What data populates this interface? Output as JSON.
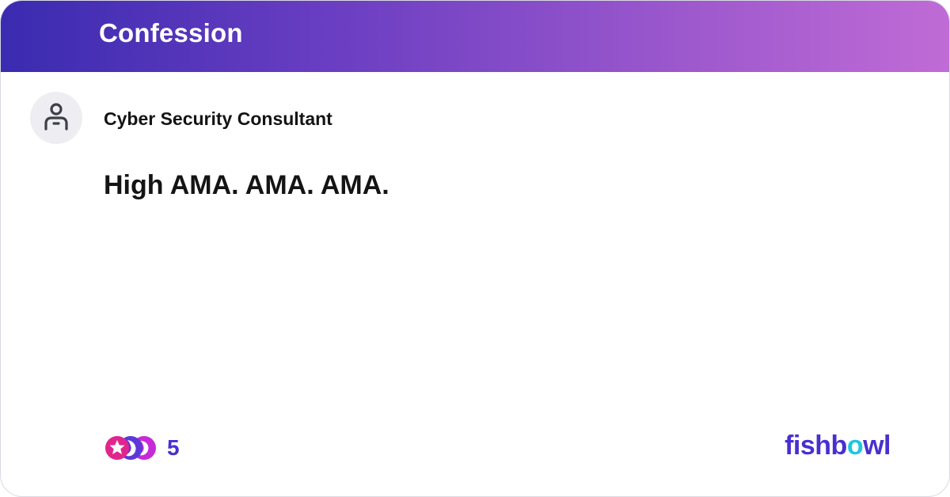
{
  "header": {
    "title": "Confession"
  },
  "post": {
    "author": "Cyber Security Consultant",
    "avatar_icon": "user-icon",
    "text": "High AMA. AMA. AMA."
  },
  "reactions": {
    "icons": [
      "star-reaction-icon",
      "moon-reaction-icon",
      "crescent-reaction-icon"
    ],
    "count": "5"
  },
  "brand": {
    "name_start": "fishb",
    "name_accent": "o",
    "name_end": "wl",
    "colors": {
      "primary": "#4a2fd0",
      "accent": "#1ec6e0"
    }
  }
}
